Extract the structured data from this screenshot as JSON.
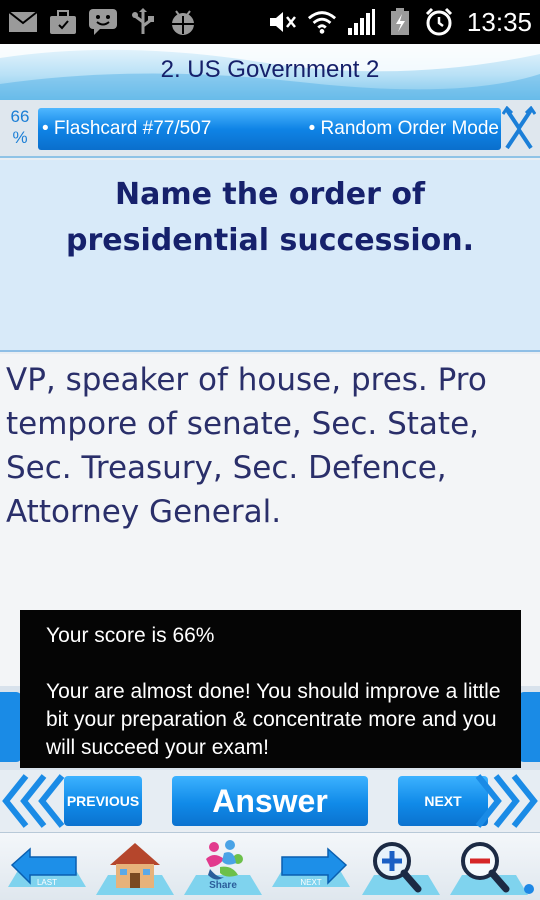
{
  "status_bar": {
    "time": "13:35",
    "left_icons": [
      "mail-icon",
      "briefcase-icon",
      "chat-icon",
      "usb-icon",
      "android-debug-icon"
    ],
    "right_icons": [
      "volume-muted-icon",
      "wifi-icon",
      "signal-icon",
      "battery-icon",
      "alarm-icon"
    ]
  },
  "header": {
    "title": "2. US Government 2"
  },
  "info": {
    "percent_line1": "66",
    "percent_line2": "%",
    "flashcard_label": "• Flashcard #77/507",
    "mode_label": "• Random Order Mode"
  },
  "card": {
    "question": "Name the order of presidential succession.",
    "answer": "VP, speaker of house, pres. Pro tempore of senate, Sec. State, Sec. Treasury, Sec. Defence, Attorney General."
  },
  "popup": {
    "score_line": "Your score is 66%",
    "message": "Your are almost done! You should improve a little bit your preparation & concentrate more and you will succeed your exam!"
  },
  "nav": {
    "previous_label": "PREVIOUS",
    "answer_label": "Answer",
    "next_label": "NEXT"
  },
  "toolbar": {
    "items": [
      {
        "name": "last-button",
        "label": "LAST",
        "icon": "arrow-left-icon"
      },
      {
        "name": "home-button",
        "label": "",
        "icon": "house-icon"
      },
      {
        "name": "share-button",
        "label": "Share",
        "icon": "share-icon"
      },
      {
        "name": "next-card-button",
        "label": "NEXT",
        "icon": "arrow-right-icon"
      },
      {
        "name": "zoom-in-button",
        "label": "",
        "icon": "zoom-in-icon"
      },
      {
        "name": "zoom-out-button",
        "label": "",
        "icon": "zoom-out-icon"
      }
    ]
  },
  "colors": {
    "accent_blue": "#108ae8",
    "title_text": "#16206a",
    "question_bg": "#d8eaf9",
    "popup_bg": "#050505"
  }
}
